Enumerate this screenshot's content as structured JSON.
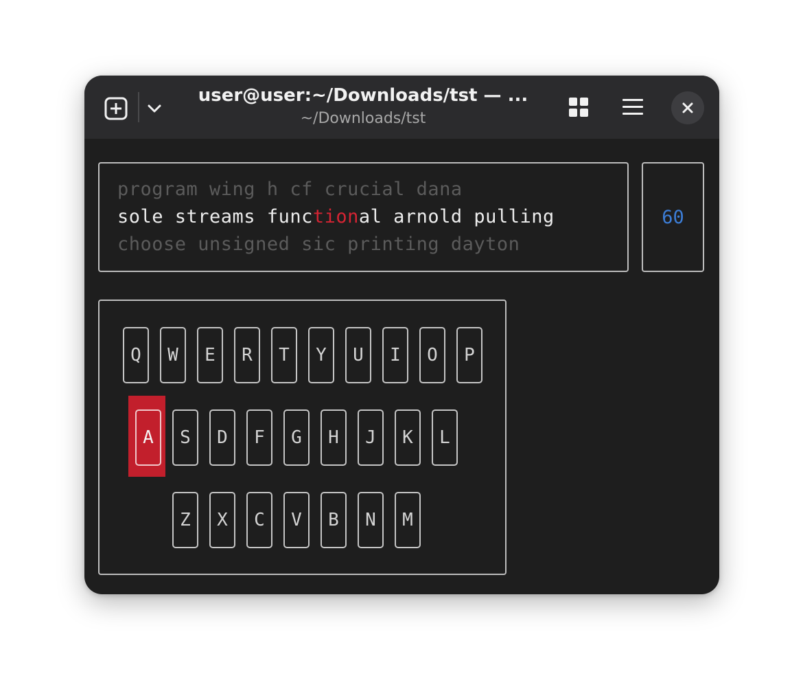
{
  "window": {
    "title": "user@user:~/Downloads/tst — ...",
    "subtitle": "~/Downloads/tst"
  },
  "toolbar": {
    "new_tab_icon": "new-tab-icon",
    "tab_menu_icon": "chevron-down-icon",
    "grid_icon": "grid-icon",
    "menu_icon": "hamburger-menu-icon",
    "close_icon": "close-icon"
  },
  "typing": {
    "previous_line": "program wing h cf crucial dana",
    "current_line": {
      "typed_correct": "sole streams func",
      "typed_wrong": "tion",
      "remaining": "al arnold pulling"
    },
    "next_line": "choose unsigned sic printing dayton"
  },
  "timer": {
    "value": "60"
  },
  "keyboard": {
    "rows": [
      [
        "Q",
        "W",
        "E",
        "R",
        "T",
        "Y",
        "U",
        "I",
        "O",
        "P"
      ],
      [
        "A",
        "S",
        "D",
        "F",
        "G",
        "H",
        "J",
        "K",
        "L"
      ],
      [
        "Z",
        "X",
        "C",
        "V",
        "B",
        "N",
        "M"
      ]
    ],
    "active_key": "A"
  },
  "colors": {
    "background": "#1e1e1e",
    "titlebar": "#2b2b2d",
    "error": "#d42433",
    "timer": "#3c7dd6",
    "active_key": "#c21f2c"
  }
}
